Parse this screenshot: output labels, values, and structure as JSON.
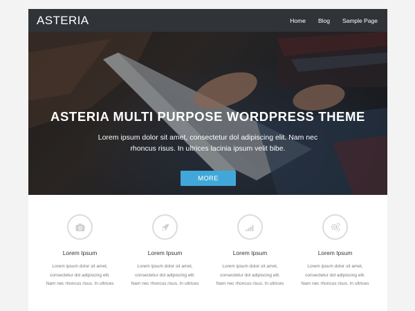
{
  "header": {
    "logo": "ASTERIA",
    "nav": [
      "Home",
      "Blog",
      "Sample Page"
    ]
  },
  "hero": {
    "title": "ASTERIA MULTI PURPOSE WORDPRESS THEME",
    "text": "Lorem ipsum dolor sit amet, consectetur dol adipiscing elit. Nam nec rhoncus risus. In ultrices lacinia ipsum velit bibe.",
    "button": "MORE"
  },
  "features": [
    {
      "icon": "camera-icon",
      "title": "Lorem Ipsum",
      "line1": "Lorem ipsum dolor sit amet,",
      "line2": "consectetur dol adipiscing elit.",
      "line3": "Nam nec rhoncus risus. In ultrices"
    },
    {
      "icon": "rocket-icon",
      "title": "Lorem Ipsum",
      "line1": "Lorem ipsum dolor sit amet,",
      "line2": "consectetur dol adipiscing elit.",
      "line3": "Nam nec rhoncus risus. In ultrices"
    },
    {
      "icon": "signal-icon",
      "title": "Lorem Ipsum",
      "line1": "Lorem ipsum dolor sit amet,",
      "line2": "consectetur dol adipiscing elit.",
      "line3": "Nam nec rhoncus risus. In ultrices"
    },
    {
      "icon": "gears-icon",
      "title": "Lorem Ipsum",
      "line1": "Lorem ipsum dolor sit amet,",
      "line2": "consectetur dol adipiscing elit.",
      "line3": "Nam nec rhoncus risus. In ultrices"
    }
  ],
  "colors": {
    "header_bg": "#303337",
    "accent": "#41a7d8",
    "page_bg": "#f3f3f3",
    "icon_circle": "#dcdcdc"
  }
}
